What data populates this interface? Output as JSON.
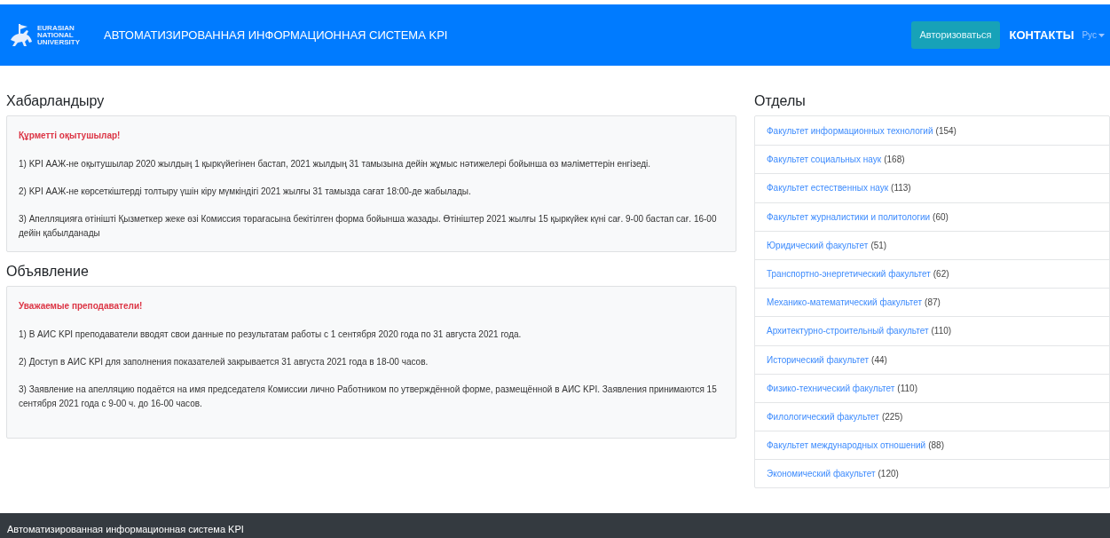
{
  "navbar": {
    "logo_lines": [
      "EURASIAN",
      "NATIONAL",
      "UNIVERSITY"
    ],
    "title": "АВТОМАТИЗИРОВАННАЯ ИНФОРМАЦИОННАЯ СИСТЕМА KPI",
    "login_button": "Авторизоваться",
    "contacts_link": "КОНТАКТЫ",
    "language": "Рус"
  },
  "announcements": [
    {
      "heading": "Хабарландыру",
      "greeting": "Құрметті оқытушылар!",
      "paragraphs": [
        "1) KPI ААЖ-не оқытушылар 2020 жылдың 1 қыркүйегінен бастап, 2021 жылдың 31 тамызына дейін жұмыс нәтижелері бойынша өз мәліметтерін енгізеді.",
        "2) KPI ААЖ-не көрсеткіштерді толтыру үшін кіру мүмкіндігі 2021 жылғы 31 тамызда сағат 18:00-де жабылады.",
        "3) Апелляцияға өтінішті Қызметкер жеке өзі Комиссия төрағасына бекітілген форма бойынша жазады. Өтініштер 2021 жылғы 15 қыркүйек күні сағ. 9-00 бастап сағ. 16-00 дейін қабылданады"
      ]
    },
    {
      "heading": "Объявление",
      "greeting": "Уважаемые преподаватели!",
      "paragraphs": [
        "1) В АИС KPI преподаватели вводят свои данные по результатам работы с 1 сентября 2020 года по 31 августа 2021 года.",
        "2) Доступ в АИС KPI для заполнения показателей закрывается 31 августа 2021 года в 18-00 часов.",
        "3) Заявление на апелляцию подаётся на имя председателя Комиссии лично Работником по утверждённой форме, размещённой в АИС KPI. Заявления принимаются 15 сентября 2021 года с 9-00 ч. до 16-00 часов."
      ]
    }
  ],
  "departments": {
    "heading": "Отделы",
    "items": [
      {
        "name": "Факультет информационных технологий",
        "count": "(154)"
      },
      {
        "name": "Факультет социальных наук",
        "count": "(168)"
      },
      {
        "name": "Факультет естественных наук",
        "count": "(113)"
      },
      {
        "name": "Факультет журналистики и политологии",
        "count": "(60)"
      },
      {
        "name": "Юридический факультет",
        "count": "(51)"
      },
      {
        "name": "Транспортно-энергетический факультет",
        "count": "(62)"
      },
      {
        "name": "Механико-математический факультет",
        "count": "(87)"
      },
      {
        "name": "Архитектурно-строительный факультет",
        "count": "(110)"
      },
      {
        "name": "Исторический факультет",
        "count": "(44)"
      },
      {
        "name": "Физико-технический факультет",
        "count": "(110)"
      },
      {
        "name": "Филологический факультет",
        "count": "(225)"
      },
      {
        "name": "Факультет международных отношений",
        "count": "(88)"
      },
      {
        "name": "Экономический факультет",
        "count": "(120)"
      }
    ]
  },
  "footer": {
    "text": "Автоматизированная информационная система KPI"
  }
}
